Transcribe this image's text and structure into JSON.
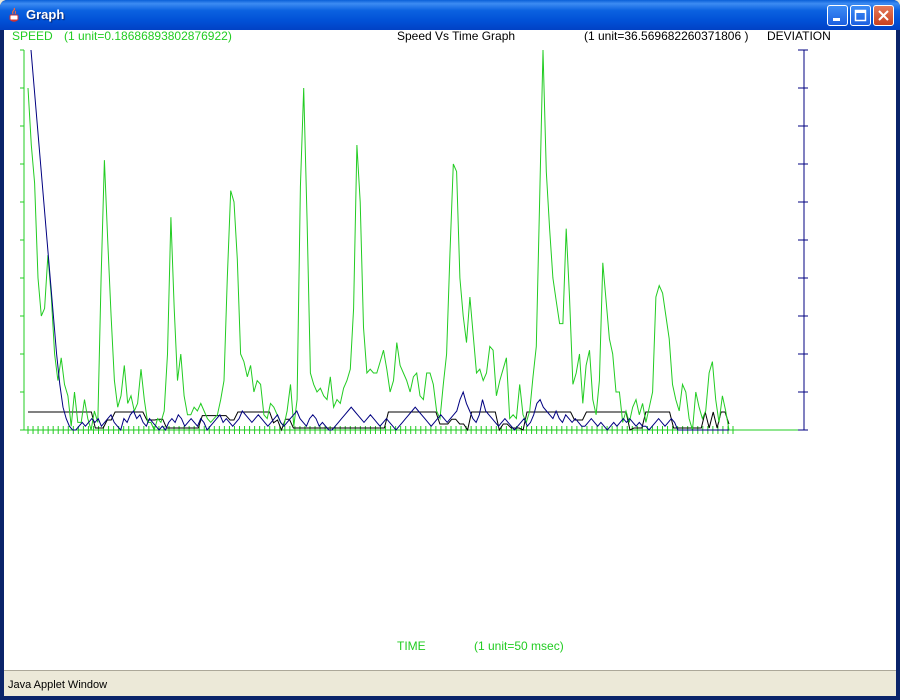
{
  "window": {
    "title": "Graph",
    "status_text": "Java Applet Window"
  },
  "graph": {
    "title": "Speed Vs Time Graph",
    "speed_label": "SPEED",
    "speed_unit": "(1 unit=0.18686893802876922)",
    "deviation_unit": "(1 unit=36.569682260371806   )",
    "deviation_label": "DEVIATION",
    "time_label": "TIME",
    "time_unit": "(1 unit=50    msec)"
  },
  "colors": {
    "speed": "#22cc22",
    "deviation": "#000080",
    "black_series": "#000000"
  },
  "chart_data": {
    "type": "line",
    "title": "Speed Vs Time Graph",
    "xlabel": "TIME (1 unit=50 msec)",
    "ylabel_left": "SPEED (1 unit=0.18686893802876922)",
    "ylabel_right": "DEVIATION (1 unit=36.569682260371806)",
    "x_tick_count": 140,
    "y_tick_count": 10,
    "grid": false,
    "series": [
      {
        "values": [
          9.0,
          7.5,
          6.5,
          4.0,
          3.0,
          3.2,
          4.6,
          3.5,
          2.0,
          1.3,
          1.9,
          1.2,
          0.9,
          0.1,
          1.0,
          0.2,
          0.2,
          0.8,
          0.3,
          0.0,
          0.5,
          0.2,
          4.0,
          7.1,
          5.0,
          3.0,
          1.3,
          0.6,
          0.9,
          1.7,
          0.7,
          0.9,
          0.5,
          0.7,
          1.6,
          0.8,
          0.2,
          0.2,
          0.0,
          0.3,
          0.2,
          0.5,
          2.0,
          5.6,
          3.2,
          1.3,
          2.0,
          0.9,
          0.4,
          0.4,
          0.6,
          0.5,
          0.7,
          0.5,
          0.3,
          0.2,
          0.3,
          0.4,
          0.8,
          1.3,
          4.0,
          6.3,
          6.0,
          4.5,
          2.0,
          1.8,
          1.4,
          1.7,
          1.0,
          1.3,
          1.2,
          0.4,
          0.3,
          0.7,
          0.6,
          0.4,
          0.2,
          0.1,
          0.5,
          1.2,
          0.1,
          0.8,
          6.4,
          9.0,
          5.5,
          1.5,
          1.2,
          1.0,
          1.1,
          0.9,
          0.8,
          1.4,
          0.6,
          0.8,
          0.7,
          1.1,
          1.3,
          1.6,
          3.2,
          7.5,
          6.0,
          2.7,
          1.5,
          1.6,
          1.5,
          1.5,
          1.8,
          2.1,
          1.6,
          1.0,
          1.3,
          2.3,
          1.7,
          1.5,
          1.3,
          1.0,
          1.4,
          1.5,
          0.9,
          0.8,
          1.5,
          1.5,
          1.2,
          0.5,
          0.3,
          1.2,
          2.0,
          4.6,
          7.0,
          6.8,
          4.0,
          3.0,
          2.3,
          3.5,
          2.5,
          1.5,
          1.6,
          1.3,
          1.5,
          2.2,
          2.1,
          0.9,
          1.3,
          1.6,
          1.9,
          0.3,
          0.4,
          0.3,
          1.2,
          0.4,
          0.2,
          0.5,
          1.4,
          2.2,
          6.0,
          10.0,
          6.8,
          5.3,
          4.0,
          3.4,
          2.8,
          2.8,
          5.3,
          3.5,
          1.2,
          1.5,
          2.0,
          0.7,
          1.7,
          2.1,
          0.8,
          0.4,
          1.3,
          4.4,
          3.4,
          2.4,
          2.0,
          1.0,
          1.0,
          0.2,
          0.5,
          0.2,
          0.6,
          0.8,
          0.4,
          0.7,
          0.2,
          0.6,
          1.0,
          3.5,
          3.8,
          3.6,
          3.0,
          2.4,
          1.2,
          0.8,
          0.5,
          1.2,
          1.0,
          0.3,
          0.0,
          1.0,
          0.6,
          0.3,
          0.5,
          1.5,
          1.8,
          0.8,
          0.2,
          0.9,
          0.5,
          0.0
        ]
      },
      {
        "values": [
          10.0,
          9.0,
          8.0,
          7.0,
          6.0,
          5.0,
          4.0,
          3.0,
          2.0,
          1.2,
          0.6,
          0.3,
          0.1,
          0.0,
          0.0,
          0.1,
          0.2,
          0.1,
          0.2,
          0.3,
          0.2,
          0.3,
          0.1,
          0.2,
          0.3,
          0.4,
          0.2,
          0.1,
          0.0,
          0.3,
          0.2,
          0.4,
          0.5,
          0.3,
          0.4,
          0.2,
          0.1,
          0.3,
          0.2,
          0.1,
          0.0,
          0.1,
          0.0,
          0.2,
          0.3,
          0.2,
          0.4,
          0.3,
          0.1,
          0.2,
          0.3,
          0.2,
          0.1,
          0.3,
          0.2,
          0.0,
          0.1,
          0.2,
          0.3,
          0.4,
          0.2,
          0.3,
          0.2,
          0.1,
          0.2,
          0.3,
          0.5,
          0.4,
          0.3,
          0.2,
          0.3,
          0.4,
          0.3,
          0.2,
          0.1,
          0.2,
          0.3,
          0.4,
          0.2,
          0.1,
          0.2,
          0.3,
          0.4,
          0.5,
          0.3,
          0.2,
          0.1,
          0.3,
          0.4,
          0.3,
          0.1,
          0.2,
          0.1,
          0.0,
          0.0,
          0.1,
          0.2,
          0.3,
          0.4,
          0.5,
          0.6,
          0.5,
          0.4,
          0.3,
          0.2,
          0.3,
          0.4,
          0.3,
          0.2,
          0.1,
          0.2,
          0.3,
          0.2,
          0.1,
          0.0,
          0.1,
          0.2,
          0.3,
          0.4,
          0.5,
          0.6,
          0.5,
          0.4,
          0.3,
          0.2,
          0.1,
          0.2,
          0.3,
          0.4,
          0.3,
          0.2,
          0.3,
          0.4,
          0.5,
          0.8,
          1.0,
          0.7,
          0.5,
          0.3,
          0.2,
          0.4,
          0.8,
          0.5,
          0.4,
          0.3,
          0.2,
          0.1,
          0.2,
          0.3,
          0.2,
          0.1,
          0.0,
          0.1,
          0.2,
          0.3,
          0.1,
          0.2,
          0.4,
          0.7,
          0.8,
          0.6,
          0.5,
          0.4,
          0.3,
          0.5,
          0.3,
          0.2,
          0.4,
          0.3,
          0.2,
          0.3,
          0.2,
          0.1,
          0.1,
          0.2,
          0.3,
          0.2,
          0.1,
          0.2,
          0.1,
          0.0,
          0.1,
          0.2,
          0.1,
          0.2,
          0.3,
          0.2,
          0.3,
          0.2,
          0.1,
          0.2,
          0.1,
          0.1,
          0.0,
          0.1,
          0.2,
          0.3,
          0.2,
          0.1,
          0.2,
          0.3,
          0.2,
          0.0,
          0.0,
          0.0,
          0.0,
          0.0,
          0.0,
          0.0,
          0.0,
          0.0,
          0.0,
          0.0,
          0.0,
          0.0,
          0.0,
          0.0,
          0.0,
          0.0
        ]
      },
      {
        "values": [
          0.5,
          0.5,
          0.5,
          0.5,
          0.5,
          0.5,
          0.5,
          0.5,
          0.5,
          0.5,
          0.5,
          0.5,
          0.5,
          0.5,
          0.5,
          0.5,
          0.5,
          -0.4,
          -0.4,
          -0.4,
          -0.2,
          -0.2,
          0.5,
          0.5,
          0.5,
          0.5,
          0.5,
          0.5,
          0.5,
          0.5,
          -0.2,
          -0.2,
          -0.2,
          0.3,
          0.3,
          -0.4,
          -0.4,
          -0.4,
          -0.4,
          -0.4,
          -0.4,
          -0.4,
          -0.4,
          -0.4,
          0.4,
          0.4,
          0.4,
          0.4,
          0.4,
          0.4,
          0.4,
          -0.2,
          -0.2,
          0.5,
          0.5,
          0.5,
          0.5,
          0.5,
          0.5,
          0.5,
          0.5,
          0.5,
          0.2,
          -0.2,
          0.0,
          0.3,
          0.3,
          -0.4,
          -0.4,
          -0.4,
          -0.4,
          -0.4,
          -0.4,
          -0.4,
          -0.4,
          -0.4,
          -0.4,
          -0.4,
          -0.4,
          -0.4,
          -0.4,
          -0.4,
          -0.4,
          -0.4,
          -0.4,
          -0.4,
          -0.4,
          -0.4,
          -0.4,
          -0.4,
          -0.4,
          0.5,
          0.5,
          0.5,
          0.5,
          0.5,
          0.5,
          0.5,
          0.5,
          0.5,
          0.5,
          0.5,
          0.5,
          0.5,
          -0.3,
          -0.3,
          -0.3,
          0.3,
          0.3,
          -0.3,
          -0.3,
          0.0,
          0.5,
          0.5,
          0.5,
          0.5,
          0.5,
          0.5,
          0.5,
          0.0,
          -0.3,
          -0.3,
          -0.4,
          -0.4,
          -0.4,
          0.0,
          0.5,
          0.5,
          0.5,
          0.5,
          0.5,
          0.5,
          0.5,
          0.5,
          0.5,
          0.5,
          0.5,
          0.5,
          -0.2,
          -0.2,
          -0.2,
          0.5,
          0.5,
          0.5,
          0.5,
          0.5,
          0.5,
          0.5,
          0.5,
          0.5,
          0.5,
          0.5,
          0.0,
          -0.4,
          -0.4,
          -0.4,
          0.5,
          0.5,
          0.5,
          0.5,
          0.5,
          0.5,
          0.5,
          -0.4,
          -0.4,
          -0.4,
          -0.4,
          -0.4,
          -0.4,
          -0.4,
          -0.4,
          0.5,
          -0.4,
          0.5,
          -0.4,
          0.5,
          0.5,
          -0.3
        ]
      }
    ]
  }
}
